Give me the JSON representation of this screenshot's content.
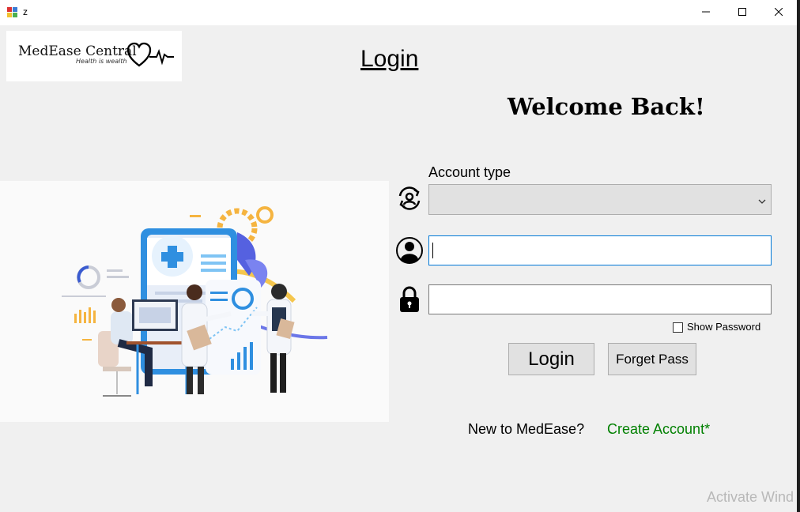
{
  "window": {
    "title": "z"
  },
  "logo": {
    "brand": "MedEase Central",
    "tagline": "Health is wealth"
  },
  "page_title": "Login",
  "welcome": "Welcome Back!",
  "form": {
    "account_type_label": "Account type",
    "account_type_value": "",
    "username_value": "",
    "password_value": "",
    "show_password_label": "Show Password",
    "show_password_checked": false,
    "login_label": "Login",
    "forget_label": "Forget Pass"
  },
  "signup": {
    "prompt": "New to MedEase?",
    "link": "Create Account*"
  },
  "watermark": "Activate Wind",
  "colors": {
    "link_green": "#008000",
    "focus_border": "#0078d7",
    "background": "#f0f0f0"
  },
  "icons": [
    "app-icon",
    "minimize-icon",
    "maximize-icon",
    "close-icon",
    "heartbeat-icon",
    "account-switch-icon",
    "user-icon",
    "lock-icon",
    "chevron-down-icon"
  ]
}
